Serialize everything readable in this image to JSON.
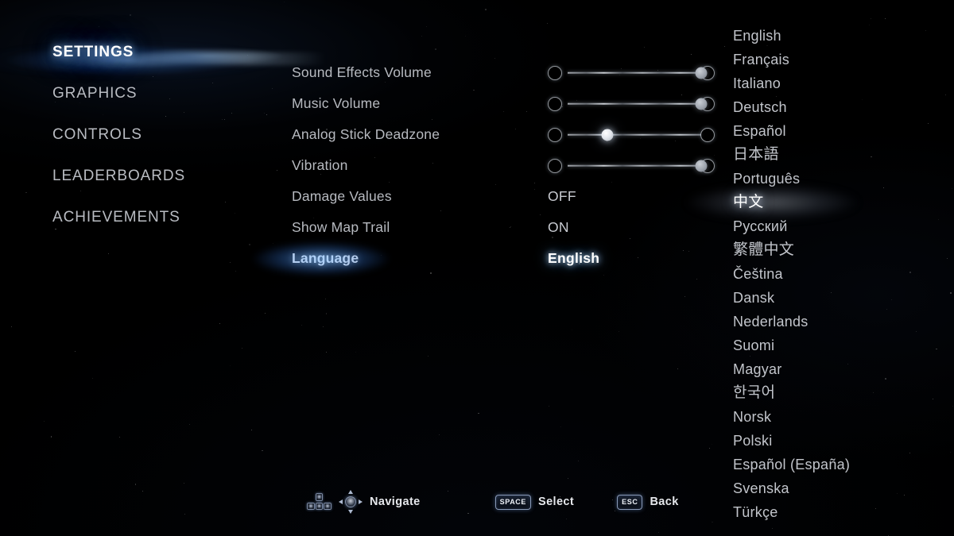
{
  "screen": {
    "title": "Settings",
    "background_color": "#000000",
    "accent_color": "#7ab8ff",
    "text_color": "#c2c5cb",
    "highlight_text_color": "#ffffff"
  },
  "sidebar": {
    "items": [
      {
        "label": "SETTINGS",
        "active": true
      },
      {
        "label": "GRAPHICS",
        "active": false
      },
      {
        "label": "CONTROLS",
        "active": false
      },
      {
        "label": "LEADERBOARDS",
        "active": false
      },
      {
        "label": "ACHIEVEMENTS",
        "active": false
      }
    ]
  },
  "options": {
    "rows": [
      {
        "label": "Sound Effects Volume",
        "type": "slider",
        "value_percent": 100,
        "selected": false
      },
      {
        "label": "Music Volume",
        "type": "slider",
        "value_percent": 100,
        "selected": false
      },
      {
        "label": "Analog Stick Deadzone",
        "type": "slider",
        "value_percent": 30,
        "selected": false
      },
      {
        "label": "Vibration",
        "type": "slider",
        "value_percent": 100,
        "selected": false
      },
      {
        "label": "Damage Values",
        "type": "text",
        "value": "OFF",
        "selected": false
      },
      {
        "label": "Show Map Trail",
        "type": "text",
        "value": "ON",
        "selected": false
      },
      {
        "label": "Language",
        "type": "text",
        "value": "English",
        "selected": true,
        "highlighted": true
      }
    ]
  },
  "language_list": {
    "items": [
      {
        "label": "English",
        "hovered": false,
        "cjk": false
      },
      {
        "label": "Français",
        "hovered": false,
        "cjk": false
      },
      {
        "label": "Italiano",
        "hovered": false,
        "cjk": false
      },
      {
        "label": "Deutsch",
        "hovered": false,
        "cjk": false
      },
      {
        "label": "Español",
        "hovered": false,
        "cjk": false
      },
      {
        "label": "日本語",
        "hovered": false,
        "cjk": true
      },
      {
        "label": "Português",
        "hovered": false,
        "cjk": false
      },
      {
        "label": "中文",
        "hovered": true,
        "cjk": true
      },
      {
        "label": "Русский",
        "hovered": false,
        "cjk": false
      },
      {
        "label": "繁體中文",
        "hovered": false,
        "cjk": true
      },
      {
        "label": "Čeština",
        "hovered": false,
        "cjk": false
      },
      {
        "label": "Dansk",
        "hovered": false,
        "cjk": false
      },
      {
        "label": "Nederlands",
        "hovered": false,
        "cjk": false
      },
      {
        "label": "Suomi",
        "hovered": false,
        "cjk": false
      },
      {
        "label": "Magyar",
        "hovered": false,
        "cjk": false
      },
      {
        "label": "한국어",
        "hovered": false,
        "cjk": true
      },
      {
        "label": "Norsk",
        "hovered": false,
        "cjk": false
      },
      {
        "label": "Polski",
        "hovered": false,
        "cjk": false
      },
      {
        "label": "Español (España)",
        "hovered": false,
        "cjk": false
      },
      {
        "label": "Svenska",
        "hovered": false,
        "cjk": false
      },
      {
        "label": "Türkçe",
        "hovered": false,
        "cjk": false
      }
    ]
  },
  "footer": {
    "hints": [
      {
        "icons": [
          "wasd-keys-icon",
          "analog-stick-icon"
        ],
        "label": "Navigate"
      },
      {
        "key": "SPACE",
        "label": "Select"
      },
      {
        "key": "ESC",
        "label": "Back"
      }
    ],
    "navigate_label": "Navigate",
    "select_key": "SPACE",
    "select_label": "Select",
    "back_key": "ESC",
    "back_label": "Back"
  }
}
